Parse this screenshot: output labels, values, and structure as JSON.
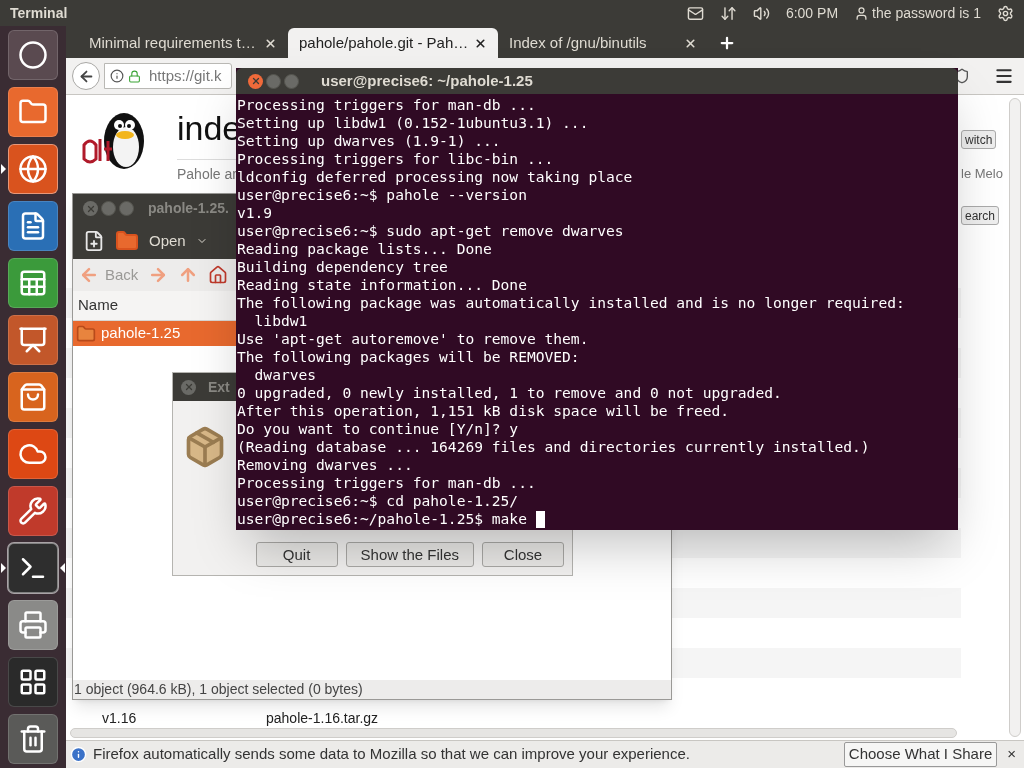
{
  "top_panel": {
    "app_title": "Terminal",
    "clock": "6:00 PM",
    "user": "the password is 1"
  },
  "launcher": {
    "items": [
      {
        "kind": "dash",
        "running": false,
        "focused": false
      },
      {
        "kind": "files",
        "running": false,
        "focused": false
      },
      {
        "kind": "browser",
        "running": true,
        "focused": false
      },
      {
        "kind": "writer",
        "running": false,
        "focused": false
      },
      {
        "kind": "calc",
        "running": false,
        "focused": false
      },
      {
        "kind": "impress",
        "running": false,
        "focused": false
      },
      {
        "kind": "software",
        "running": false,
        "focused": false
      },
      {
        "kind": "ubuntu_one",
        "running": false,
        "focused": false
      },
      {
        "kind": "settings",
        "running": false,
        "focused": false
      },
      {
        "kind": "terminal",
        "running": true,
        "focused": true
      },
      {
        "kind": "scanner",
        "running": false,
        "focused": false
      },
      {
        "kind": "workspaces",
        "running": false,
        "focused": false
      },
      {
        "kind": "trash",
        "running": false,
        "focused": false
      }
    ]
  },
  "browser": {
    "tabs": [
      {
        "label": "Minimal requirements t…",
        "selected": false
      },
      {
        "label": "pahole/pahole.git - Pah…",
        "selected": true
      },
      {
        "label": "Index of /gnu/binutils",
        "selected": false
      }
    ],
    "url": "https://git.k",
    "page": {
      "heading": "inde",
      "subtitle": "Pahole ar",
      "switch_button": "witch",
      "author": "le Melo",
      "search_button": "earch",
      "rows": [
        {
          "version": "v1.16",
          "file": "pahole-1.16.tar.gz"
        }
      ]
    },
    "notification": {
      "text": "Firefox automatically sends some data to Mozilla so that we can improve your experience.",
      "button": "Choose What I Share",
      "close": "×"
    }
  },
  "file_manager": {
    "title": "pahole-1.25.",
    "open_button": "Open",
    "back_button": "Back",
    "column": "Name",
    "items": [
      {
        "name": "pahole-1.25",
        "selected": true
      }
    ],
    "status": "1 object (964.6 kB), 1 object selected (0 bytes)"
  },
  "dialog": {
    "title": "Ext",
    "buttons": [
      "Quit",
      "Show the Files",
      "Close"
    ]
  },
  "terminal": {
    "title": "user@precise6: ~/pahole-1.25",
    "cursor": true,
    "lines": [
      "Processing triggers for man-db ...",
      "Setting up libdw1 (0.152-1ubuntu3.1) ...",
      "Setting up dwarves (1.9-1) ...",
      "Processing triggers for libc-bin ...",
      "ldconfig deferred processing now taking place",
      "user@precise6:~$ pahole --version",
      "v1.9",
      "user@precise6:~$ sudo apt-get remove dwarves",
      "Reading package lists... Done",
      "Building dependency tree",
      "Reading state information... Done",
      "The following package was automatically installed and is no longer required:",
      "  libdw1",
      "Use 'apt-get autoremove' to remove them.",
      "The following packages will be REMOVED:",
      "  dwarves",
      "0 upgraded, 0 newly installed, 1 to remove and 0 not upgraded.",
      "After this operation, 1,151 kB disk space will be freed.",
      "Do you want to continue [Y/n]? y",
      "(Reading database ... 164269 files and directories currently installed.)",
      "Removing dwarves ...",
      "Processing triggers for man-db ...",
      "user@precise6:~$ cd pahole-1.25/",
      "user@precise6:~/pahole-1.25$ make"
    ]
  }
}
